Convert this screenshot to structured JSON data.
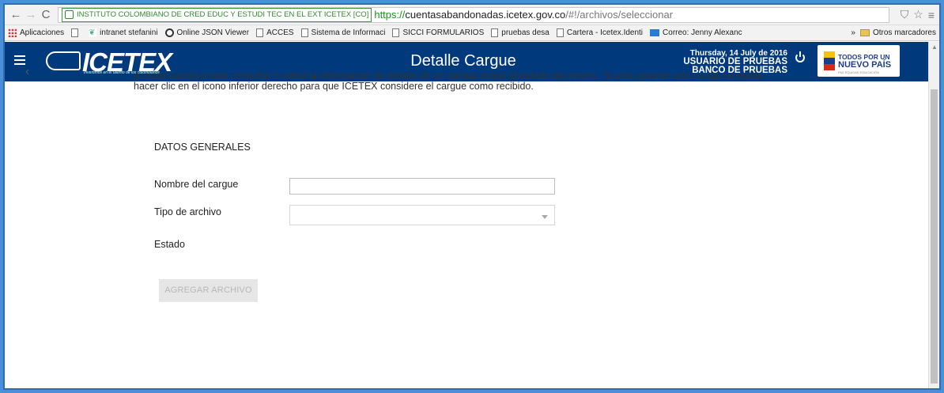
{
  "browser": {
    "ev_cert": "INSTITUTO COLOMBIANO DE CRED EDUC Y ESTUDI TEC EN EL EXT ICETEX [CO]",
    "url_scheme": "https://",
    "url_host": "cuentasabandonadas.icetex.gov.co",
    "url_path": "/#!/archivos/seleccionar"
  },
  "bookmarks": {
    "items": [
      {
        "label": "Aplicaciones",
        "icon": "apps-grid-icon"
      },
      {
        "label": "",
        "icon": "page-icon"
      },
      {
        "label": "intranet stefanini",
        "icon": "leaf-icon"
      },
      {
        "label": "Online JSON Viewer",
        "icon": "circle-icon"
      },
      {
        "label": "ACCES",
        "icon": "page-icon"
      },
      {
        "label": "Sistema de Informaci",
        "icon": "page-icon"
      },
      {
        "label": "SICCI FORMULARIOS",
        "icon": "page-icon"
      },
      {
        "label": "pruebas desa",
        "icon": "page-icon"
      },
      {
        "label": "Cartera - Icetex.Identi",
        "icon": "page-icon"
      },
      {
        "label": "Correo: Jenny Alexanc",
        "icon": "mail-icon"
      }
    ],
    "overflow": "»",
    "other_label": "Otros marcadores"
  },
  "header": {
    "logo_text": "ICETEX",
    "logo_tagline": "Invertimos en el talento de los colombianos",
    "title": "Detalle Cargue",
    "date": "Thursday, 14 July de 2016",
    "user": "USUARIO DE PRUEBAS",
    "bank": "BANCO DE PRUEBAS",
    "gov_line1": "TODOS POR UN",
    "gov_line2": "NUEVO PAÍS",
    "gov_line3": "PAZ  EQUIDAD  EDUCACIÓN"
  },
  "content": {
    "back_glyph": "‹",
    "intro_line1": "A continuación puede consultar o editar la información de detalle de un cargue según el estado del mismo. Si está creando uno nuevo no olvide",
    "intro_line2": "hacer clic en el icono inferior derecho para que ICETEX considere el cargue como recibido.",
    "section_title": "DATOS GENERALES",
    "nombre_label": "Nombre del cargue",
    "nombre_value": "",
    "tipo_label": "Tipo de archivo",
    "tipo_value": "",
    "estado_label": "Estado",
    "add_button": "AGREGAR ARCHIVO"
  },
  "colors": {
    "header_bg": "#003a7d",
    "frame_border": "#2e6db4",
    "ev_green": "#2f8a2f"
  }
}
